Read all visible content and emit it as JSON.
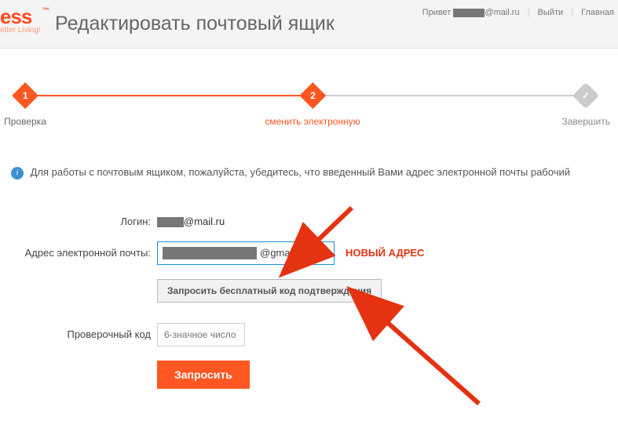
{
  "header": {
    "logo_text": "ess",
    "logo_tm": "™",
    "logo_sub": "etter Living!",
    "page_title": "Редактировать почтовый ящик"
  },
  "userbar": {
    "greeting": "Привет",
    "email_suffix": "@mail.ru",
    "logout": "Выйти",
    "home": "Главная"
  },
  "steps": {
    "s1": {
      "num": "1",
      "label": "Проверка"
    },
    "s2": {
      "num": "2",
      "label": "сменить электронную"
    },
    "s3": {
      "label": "Завершить"
    }
  },
  "info": {
    "text": "Для работы с почтовым ящиком, пожалуйста, убедитесь, что введенный Вами адрес электронной почты рабочий"
  },
  "form": {
    "login_label": "Логин:",
    "login_suffix": "@mail.ru",
    "email_label": "Адрес электронной почты:",
    "email_domain": "@gmail.cor",
    "annot_new": "НОВЫЙ АДРЕС",
    "request_code_btn": "Запросить бесплатный код подтверждения",
    "code_label": "Проверочный код",
    "code_placeholder": "6-значное число",
    "submit_btn": "Запросить"
  },
  "colors": {
    "accent": "#ff5722",
    "link": "#1e90e8"
  }
}
